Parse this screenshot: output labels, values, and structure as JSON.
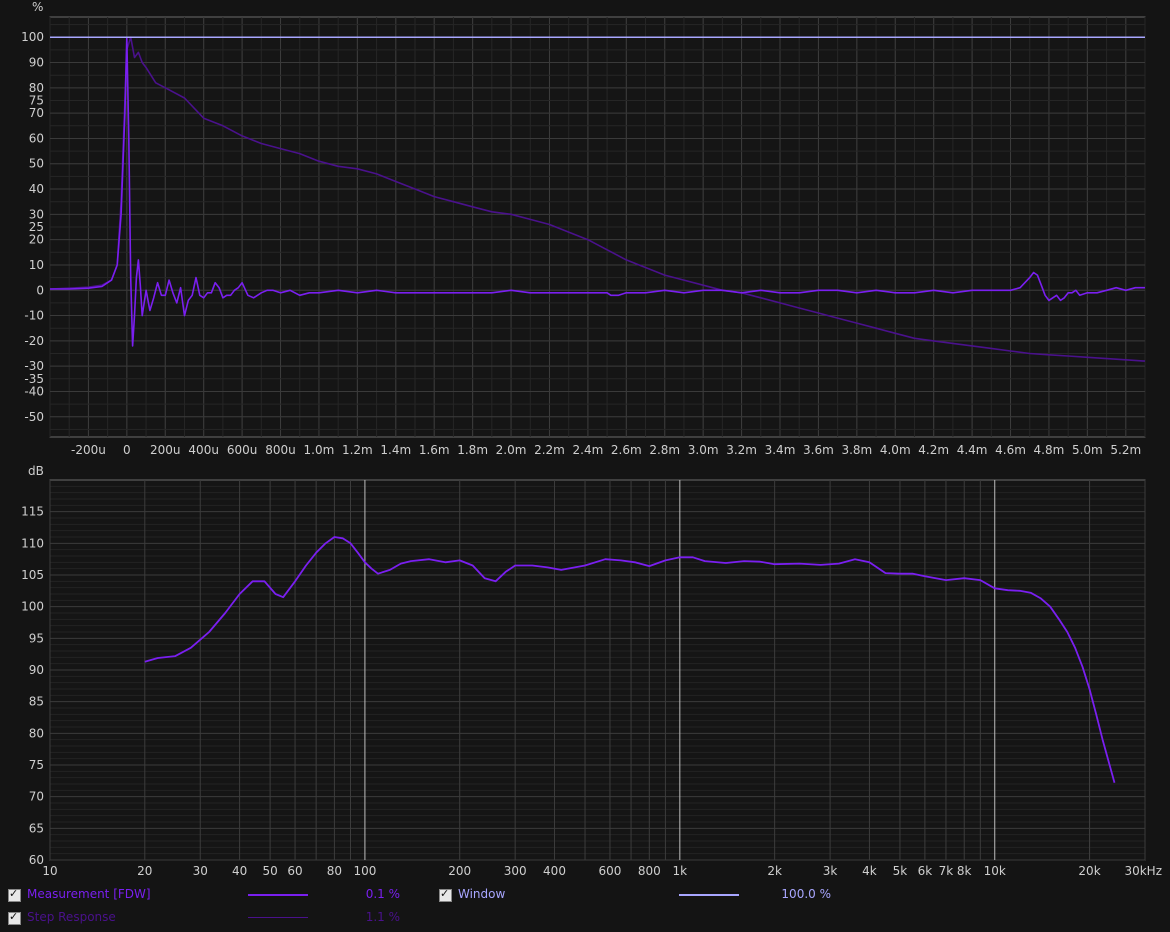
{
  "units": {
    "top_y": "%",
    "bottom_y": "dB"
  },
  "legend": [
    {
      "label": "Measurement [FDW]",
      "value": "0.1 %",
      "color": "#7a1ff0",
      "checked": true
    },
    {
      "label": "Step Response",
      "value": "1.1 %",
      "color": "#4a118c",
      "checked": true
    },
    {
      "label": "Window",
      "value": "100.0 %",
      "color": "#a8a6ff",
      "checked": true
    }
  ],
  "chart_data": [
    {
      "type": "line",
      "panel": "time",
      "ylabel": "%",
      "xlim": [
        -0.0004,
        0.0053
      ],
      "ylim": [
        -58,
        108
      ],
      "x_ticks": [
        -0.0002,
        0,
        0.0002,
        0.0004,
        0.0006,
        0.0008,
        0.001,
        0.0012,
        0.0014,
        0.0016,
        0.0018,
        0.002,
        0.0022,
        0.0024,
        0.0026,
        0.0028,
        0.003,
        0.0032,
        0.0034,
        0.0036,
        0.0038,
        0.004,
        0.0042,
        0.0044,
        0.0046,
        0.0048,
        0.005,
        0.0052
      ],
      "x_tick_labels": [
        "-200u",
        "0",
        "200u",
        "400u",
        "600u",
        "800u",
        "1.0m",
        "1.2m",
        "1.4m",
        "1.6m",
        "1.8m",
        "2.0m",
        "2.2m",
        "2.4m",
        "2.6m",
        "2.8m",
        "3.0m",
        "3.2m",
        "3.4m",
        "3.6m",
        "3.8m",
        "4.0m",
        "4.2m",
        "4.4m",
        "4.6m",
        "4.8m",
        "5.0m",
        "5.2m"
      ],
      "y_ticks": [
        100,
        90,
        80,
        75,
        70,
        60,
        50,
        40,
        30,
        25,
        20,
        10,
        0,
        -10,
        -20,
        -30,
        -35,
        -40,
        -50
      ],
      "y_tick_labels": [
        "100",
        "90",
        "80",
        "75",
        "70",
        "60",
        "50",
        "40",
        "30",
        "25",
        "20",
        "10",
        "0",
        "-10",
        "-20",
        "-30",
        "-35",
        "-40",
        "-50"
      ],
      "series": [
        {
          "name": "Window",
          "color": "#a8a6ff",
          "x": [
            -0.0004,
            0.0053
          ],
          "y": [
            100,
            100
          ]
        },
        {
          "name": "Measurement [FDW]",
          "color": "#7a1ff0",
          "x": [
            -0.0004,
            -0.0003,
            -0.0002,
            -0.00013,
            -8e-05,
            -5e-05,
            -3e-05,
            -1e-05,
            0,
            1e-05,
            2e-05,
            3e-05,
            4e-05,
            5e-05,
            6e-05,
            7e-05,
            8e-05,
            0.0001,
            0.00012,
            0.00014,
            0.00016,
            0.00018,
            0.0002,
            0.00022,
            0.00024,
            0.00026,
            0.00028,
            0.0003,
            0.00032,
            0.00034,
            0.00036,
            0.00038,
            0.0004,
            0.00042,
            0.00044,
            0.00046,
            0.00048,
            0.0005,
            0.00052,
            0.00054,
            0.00056,
            0.00058,
            0.0006,
            0.00063,
            0.00066,
            0.0007,
            0.00073,
            0.00076,
            0.0008,
            0.00085,
            0.0009,
            0.00095,
            0.001,
            0.0011,
            0.0012,
            0.0013,
            0.0014,
            0.0015,
            0.0016,
            0.0017,
            0.0018,
            0.0019,
            0.002,
            0.0021,
            0.0022,
            0.0023,
            0.0024,
            0.0025,
            0.00252,
            0.00256,
            0.0026,
            0.0027,
            0.0028,
            0.0029,
            0.003,
            0.0031,
            0.0032,
            0.0033,
            0.0034,
            0.0035,
            0.0036,
            0.0037,
            0.0038,
            0.0039,
            0.004,
            0.0041,
            0.0042,
            0.0043,
            0.0044,
            0.0045,
            0.0046,
            0.00465,
            0.0047,
            0.00472,
            0.00474,
            0.00476,
            0.00478,
            0.0048,
            0.00482,
            0.00484,
            0.00486,
            0.00488,
            0.0049,
            0.00492,
            0.00494,
            0.00496,
            0.005,
            0.00505,
            0.0051,
            0.00515,
            0.0052,
            0.00525,
            0.0053
          ],
          "y": [
            0.5,
            0.5,
            0.8,
            1.5,
            4,
            10,
            30,
            70,
            100,
            60,
            5,
            -22,
            -10,
            5,
            12,
            2,
            -10,
            0,
            -8,
            -3,
            3,
            -2,
            -2,
            4,
            -1,
            -5,
            1,
            -10,
            -4,
            -2,
            5,
            -2,
            -3,
            -1,
            -1,
            3,
            1,
            -3,
            -2,
            -2,
            0,
            1,
            3,
            -2,
            -3,
            -1,
            0,
            0,
            -1,
            0,
            -2,
            -1,
            -1,
            0,
            -1,
            0,
            -1,
            -1,
            -1,
            -1,
            -1,
            -1,
            0,
            -1,
            -1,
            -1,
            -1,
            -1,
            -2,
            -2,
            -1,
            -1,
            0,
            -1,
            0,
            0,
            -1,
            0,
            -1,
            -1,
            0,
            0,
            -1,
            0,
            -1,
            -1,
            0,
            -1,
            0,
            0,
            0,
            1,
            5,
            7,
            6,
            2,
            -2,
            -4,
            -3,
            -2,
            -4,
            -3,
            -1,
            -1,
            0,
            -2,
            -1,
            -1,
            0,
            1,
            0,
            1,
            1
          ]
        },
        {
          "name": "Step Response",
          "color": "#4a118c",
          "x": [
            -0.0004,
            -0.0003,
            -0.0002,
            -0.00013,
            -8e-05,
            -5e-05,
            -3e-05,
            -1e-05,
            0,
            2e-05,
            4e-05,
            6e-05,
            8e-05,
            0.0001,
            0.00015,
            0.0002,
            0.0003,
            0.0004,
            0.0005,
            0.0006,
            0.0007,
            0.0008,
            0.0009,
            0.001,
            0.0011,
            0.0012,
            0.0013,
            0.0014,
            0.0015,
            0.0016,
            0.0017,
            0.0018,
            0.0019,
            0.002,
            0.0021,
            0.0022,
            0.0023,
            0.0024,
            0.0025,
            0.0026,
            0.0027,
            0.0028,
            0.0029,
            0.003,
            0.0031,
            0.0032,
            0.0033,
            0.0034,
            0.0035,
            0.0036,
            0.0037,
            0.0038,
            0.0039,
            0.004,
            0.0041,
            0.0042,
            0.0043,
            0.0044,
            0.0045,
            0.0046,
            0.0047,
            0.0048,
            0.0049,
            0.005,
            0.0051,
            0.0052,
            0.0053
          ],
          "y": [
            0.5,
            0.8,
            1.2,
            2,
            4,
            10,
            35,
            75,
            95,
            100,
            92,
            94,
            90,
            88,
            82,
            80,
            76,
            68,
            65,
            61,
            58,
            56,
            54,
            51,
            49,
            48,
            46,
            43,
            40,
            37,
            35,
            33,
            31,
            30,
            28,
            26,
            23,
            20,
            16,
            12,
            9,
            6,
            4,
            2,
            0,
            -1,
            -3,
            -5,
            -7,
            -9,
            -11,
            -13,
            -15,
            -17,
            -19,
            -20,
            -21,
            -22,
            -23,
            -24,
            -25,
            -25.5,
            -26,
            -26.5,
            -27,
            -27.5,
            -28
          ]
        }
      ]
    },
    {
      "type": "line",
      "panel": "frequency",
      "ylabel": "dB",
      "x_scale": "log",
      "xlim": [
        10,
        30000
      ],
      "ylim": [
        60,
        120
      ],
      "x_ticks": [
        10,
        20,
        30,
        40,
        50,
        60,
        80,
        100,
        200,
        300,
        400,
        600,
        800,
        1000,
        2000,
        3000,
        4000,
        5000,
        6000,
        7000,
        8000,
        10000,
        20000,
        30000
      ],
      "x_tick_labels": [
        "10",
        "20",
        "30",
        "40",
        "50",
        "60",
        "80",
        "100",
        "200",
        "300",
        "400",
        "600",
        "800",
        "1k",
        "2k",
        "3k",
        "4k",
        "5k",
        "6k",
        "7k",
        "8k",
        "10k",
        "20k",
        "30kHz"
      ],
      "y_ticks": [
        115,
        110,
        105,
        100,
        95,
        90,
        85,
        80,
        75,
        70,
        65,
        60
      ],
      "y_tick_labels": [
        "115",
        "110",
        "105",
        "100",
        "95",
        "90",
        "85",
        "80",
        "75",
        "70",
        "65",
        "60"
      ],
      "series": [
        {
          "name": "Measurement [FDW]",
          "color": "#7a1ff0",
          "x": [
            20,
            22,
            25,
            28,
            32,
            36,
            40,
            44,
            48,
            52,
            55,
            60,
            65,
            70,
            75,
            80,
            85,
            90,
            95,
            100,
            105,
            110,
            120,
            130,
            140,
            160,
            180,
            200,
            220,
            240,
            260,
            280,
            300,
            340,
            380,
            420,
            500,
            580,
            650,
            720,
            800,
            900,
            1000,
            1100,
            1200,
            1400,
            1600,
            1800,
            2000,
            2400,
            2800,
            3200,
            3600,
            4000,
            4500,
            5000,
            5500,
            6000,
            7000,
            8000,
            9000,
            10000,
            11000,
            12000,
            13000,
            14000,
            15000,
            16000,
            17000,
            18000,
            19000,
            20000,
            21000,
            22000,
            23000,
            24000
          ],
          "y": [
            91.3,
            91.9,
            92.2,
            93.5,
            96,
            99,
            102,
            104,
            104,
            102,
            101.5,
            104,
            106.5,
            108.5,
            110,
            111,
            110.8,
            110,
            108.5,
            107,
            106,
            105.2,
            105.8,
            106.8,
            107.2,
            107.5,
            107,
            107.3,
            106.5,
            104.5,
            104,
            105.5,
            106.5,
            106.5,
            106.2,
            105.8,
            106.5,
            107.5,
            107.3,
            107,
            106.4,
            107.3,
            107.8,
            107.8,
            107.2,
            106.9,
            107.2,
            107.1,
            106.7,
            106.8,
            106.6,
            106.8,
            107.5,
            107,
            105.3,
            105.2,
            105.2,
            104.8,
            104.2,
            104.5,
            104.2,
            102.9,
            102.6,
            102.5,
            102.2,
            101.3,
            100,
            98,
            96,
            93.5,
            90.5,
            87,
            83,
            79,
            75.5,
            72.2
          ]
        }
      ]
    }
  ]
}
